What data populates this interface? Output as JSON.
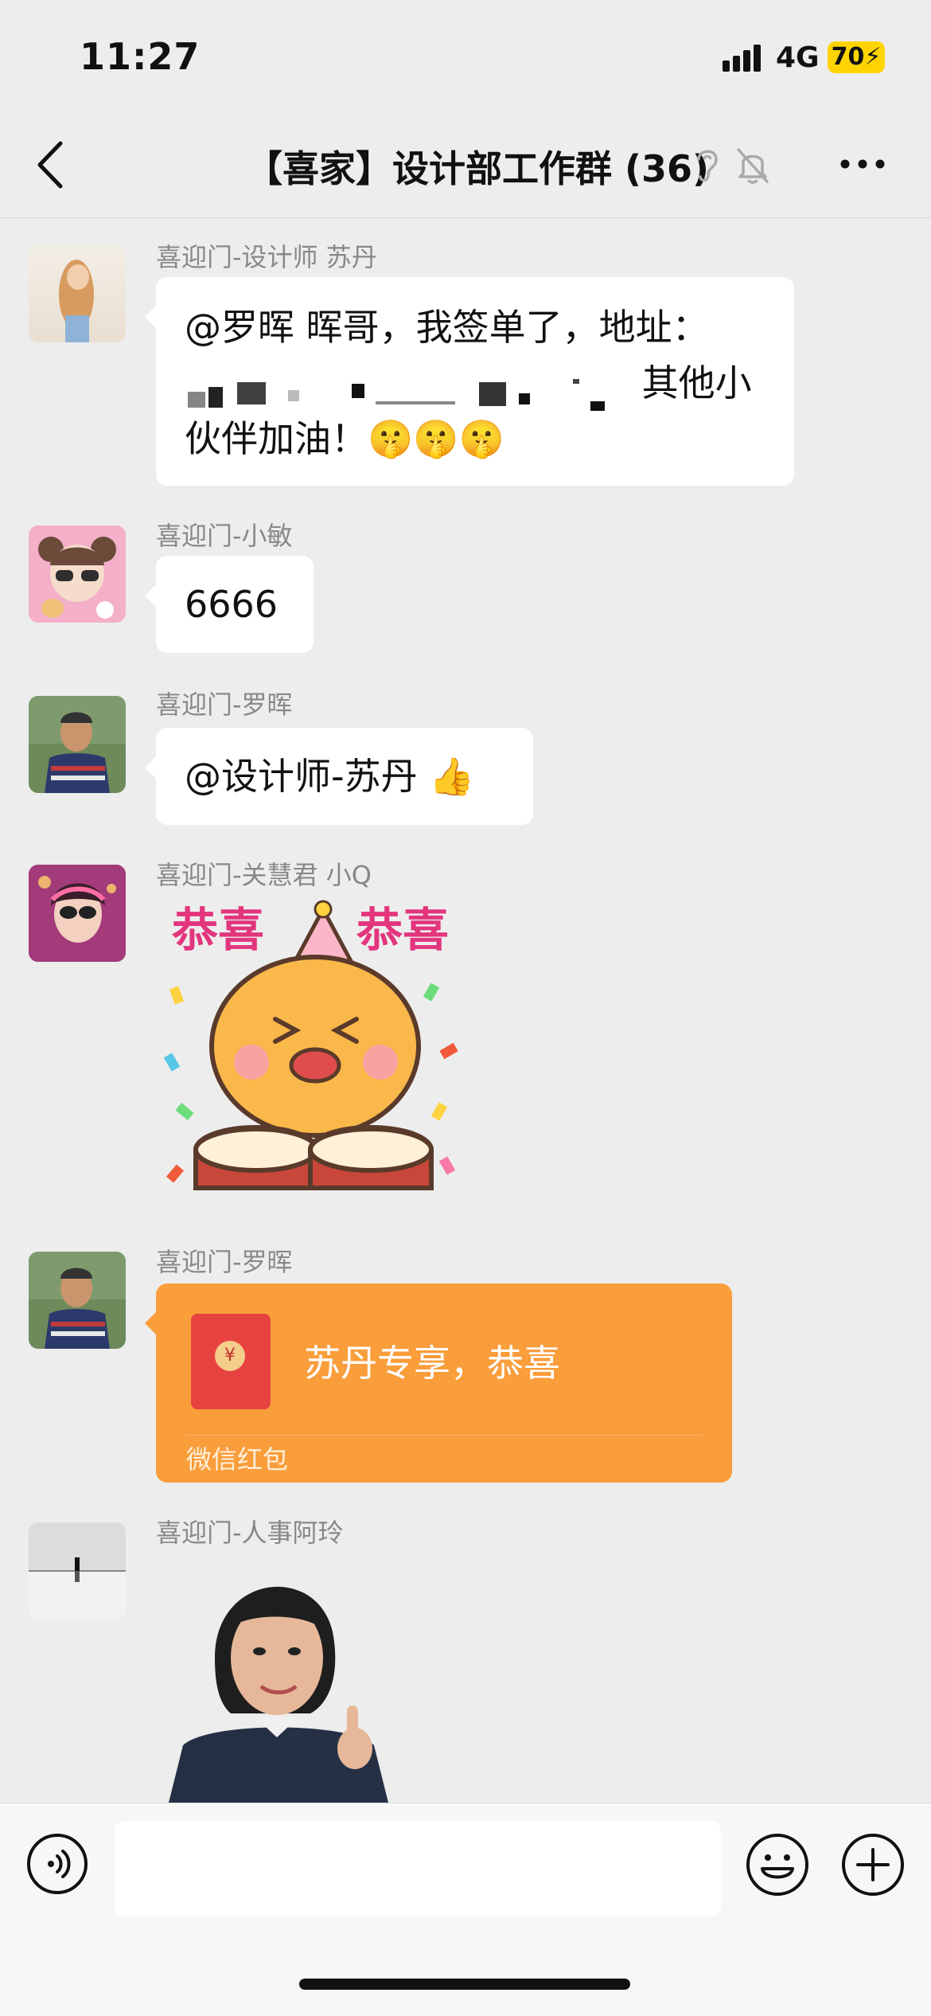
{
  "status": {
    "time": "11:27",
    "network": "4G",
    "battery": "70"
  },
  "nav": {
    "title": "【喜家】设计部工作群 (36)"
  },
  "messages": [
    {
      "sender": "喜迎门-设计师 苏丹",
      "text_line1": "@罗晖 晖哥，我签单了，地址：",
      "text_line2_tail": "其他小",
      "text_line3": "伙伴加油！🤫🤫🤫"
    },
    {
      "sender": "喜迎门-小敏",
      "text": "6666"
    },
    {
      "sender": "喜迎门-罗晖",
      "text": "@设计师-苏丹 👍"
    },
    {
      "sender": "喜迎门-关慧君 小Q",
      "sticker_text_left": "恭喜",
      "sticker_text_right": "恭喜"
    },
    {
      "sender": "喜迎门-罗晖",
      "redpacket_title": "苏丹专享，恭喜",
      "redpacket_label": "微信红包",
      "redpacket_symbol": "¥"
    },
    {
      "sender": "喜迎门-人事阿玲"
    }
  ],
  "colors": {
    "background": "#ededed",
    "bubble": "#ffffff",
    "redpacket": "#fa9d3b",
    "battery": "#ffd400"
  },
  "icons": [
    "back-arrow-icon",
    "ear-icon",
    "mute-bell-icon",
    "more-icon",
    "voice-icon",
    "emoji-icon",
    "plus-icon"
  ]
}
